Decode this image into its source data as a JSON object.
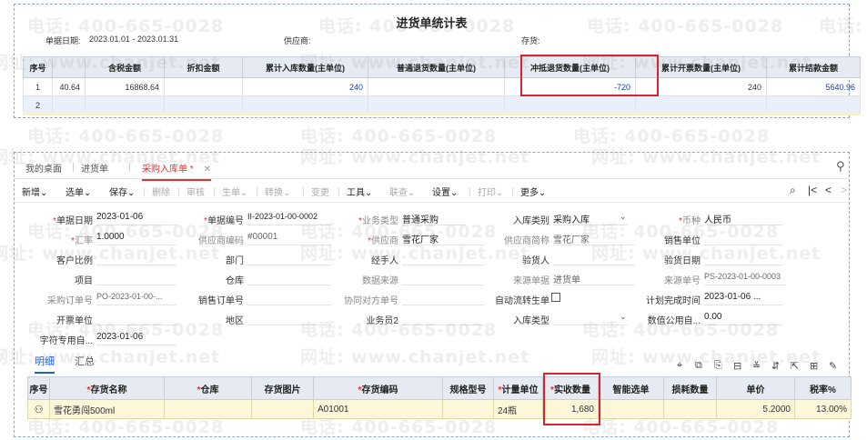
{
  "watermark": {
    "tel": "电话: 400-665-0028",
    "site": "网址: www.chanjet.net"
  },
  "report": {
    "title": "进货单统计表",
    "filters": {
      "date_label": "单据日期:",
      "date_value": "2023.01.01 - 2023.01.31",
      "supplier_label": "供应商:",
      "stock_label": "存货:"
    },
    "columns": [
      "序号",
      "含税金额",
      "折扣金额",
      "累计入库数量(主单位)",
      "普通退货数量(主单位)",
      "冲抵退货数量(主单位)",
      "累计开票数量(主单位)",
      "累计结款金额"
    ],
    "rows": [
      {
        "seq": "1",
        "pre": "40.64",
        "tax_amount": "16868.64",
        "discount": "",
        "cum_in": "240",
        "normal_return": "",
        "offset_return": "-720",
        "cum_invoice": "240",
        "cum_settle": "5640.96"
      },
      {
        "seq": "2"
      }
    ]
  },
  "tabs": {
    "home": "我的桌面",
    "purchase": "进货单",
    "active": "采购入库单 *",
    "close": "✕",
    "search": "⚲"
  },
  "toolbar": {
    "new": "新增",
    "select": "选单",
    "save": "保存",
    "delete": "删除",
    "review": "审核",
    "generate": "生单",
    "convert": "转换",
    "change": "变更",
    "tools": "工具",
    "link": "联查",
    "settings": "设置",
    "print": "打印",
    "more": "更多",
    "caret": "⌄",
    "icon_find": "⌕",
    "icon_first": "|<",
    "icon_prev": "<",
    "icon_next": ">"
  },
  "form": {
    "doc_date": {
      "label": "单据日期",
      "value": "2023-01-06"
    },
    "doc_no": {
      "label": "单据编号",
      "value": "II-2023-01-00-0002"
    },
    "biz_type": {
      "label": "业务类型",
      "value": "普通采购"
    },
    "in_type": {
      "label": "入库类别",
      "value": "采购入库"
    },
    "currency": {
      "label": "币种",
      "value": "人民币"
    },
    "rate": {
      "label": "汇率",
      "value": "1.0000"
    },
    "supplier_code": {
      "label": "供应商编码",
      "value": "#00001"
    },
    "supplier": {
      "label": "供应商",
      "value": "雪花厂家"
    },
    "supplier_short": {
      "label": "供应商简称",
      "value": "雪花厂家"
    },
    "sales_unit": {
      "label": "销售单位",
      "value": ""
    },
    "customer_ratio": {
      "label": "客户比例",
      "value": ""
    },
    "dept": {
      "label": "部门",
      "value": ""
    },
    "handler": {
      "label": "经手人",
      "value": ""
    },
    "inspector": {
      "label": "验货人",
      "value": ""
    },
    "inspect_date": {
      "label": "验货日期",
      "value": ""
    },
    "project": {
      "label": "项目",
      "value": ""
    },
    "warehouse": {
      "label": "仓库",
      "value": ""
    },
    "data_source": {
      "label": "数据来源",
      "value": ""
    },
    "source_doc": {
      "label": "来源单据",
      "value": "进货单"
    },
    "source_no": {
      "label": "来源单号",
      "value": "PS-2023-01-00-0003"
    },
    "po_no": {
      "label": "采购订单号",
      "value": "PO-2023-01-00-..."
    },
    "sales_order": {
      "label": "销售订单号",
      "value": ""
    },
    "partner_no": {
      "label": "协同对方单号",
      "value": ""
    },
    "auto_flow": {
      "label": "自动流转生单",
      "value": ""
    },
    "plan_time": {
      "label": "计划完成时间",
      "value": "2023-01-06 ..."
    },
    "invoice_unit": {
      "label": "开票单位",
      "value": ""
    },
    "region": {
      "label": "地区",
      "value": ""
    },
    "salesman2": {
      "label": "业务员2",
      "value": ""
    },
    "stock_type": {
      "label": "入库类型",
      "value": ""
    },
    "qty_public": {
      "label": "数值公用自...",
      "value": "0.00"
    },
    "char_public": {
      "label": "字符专用自...",
      "value": "2023-01-06"
    }
  },
  "subtabs": {
    "detail": "明细",
    "summary": "汇总"
  },
  "detail": {
    "columns": [
      "序号",
      "存货名称",
      "仓库",
      "存货图片",
      "存货编码",
      "规格型号",
      "计量单位",
      "实收数量",
      "智能选单",
      "损耗数量",
      "单价",
      "税率%"
    ],
    "row": {
      "name": "雪花勇闯500ml",
      "code": "A01001",
      "unit": "24瓶",
      "qty": "1,680",
      "price": "5.2000",
      "tax_rate": "13.00%"
    }
  },
  "colors": {
    "accent_red": "#e0332f",
    "link_blue": "#1d5bd8",
    "highlight_box": "#d9232e"
  }
}
